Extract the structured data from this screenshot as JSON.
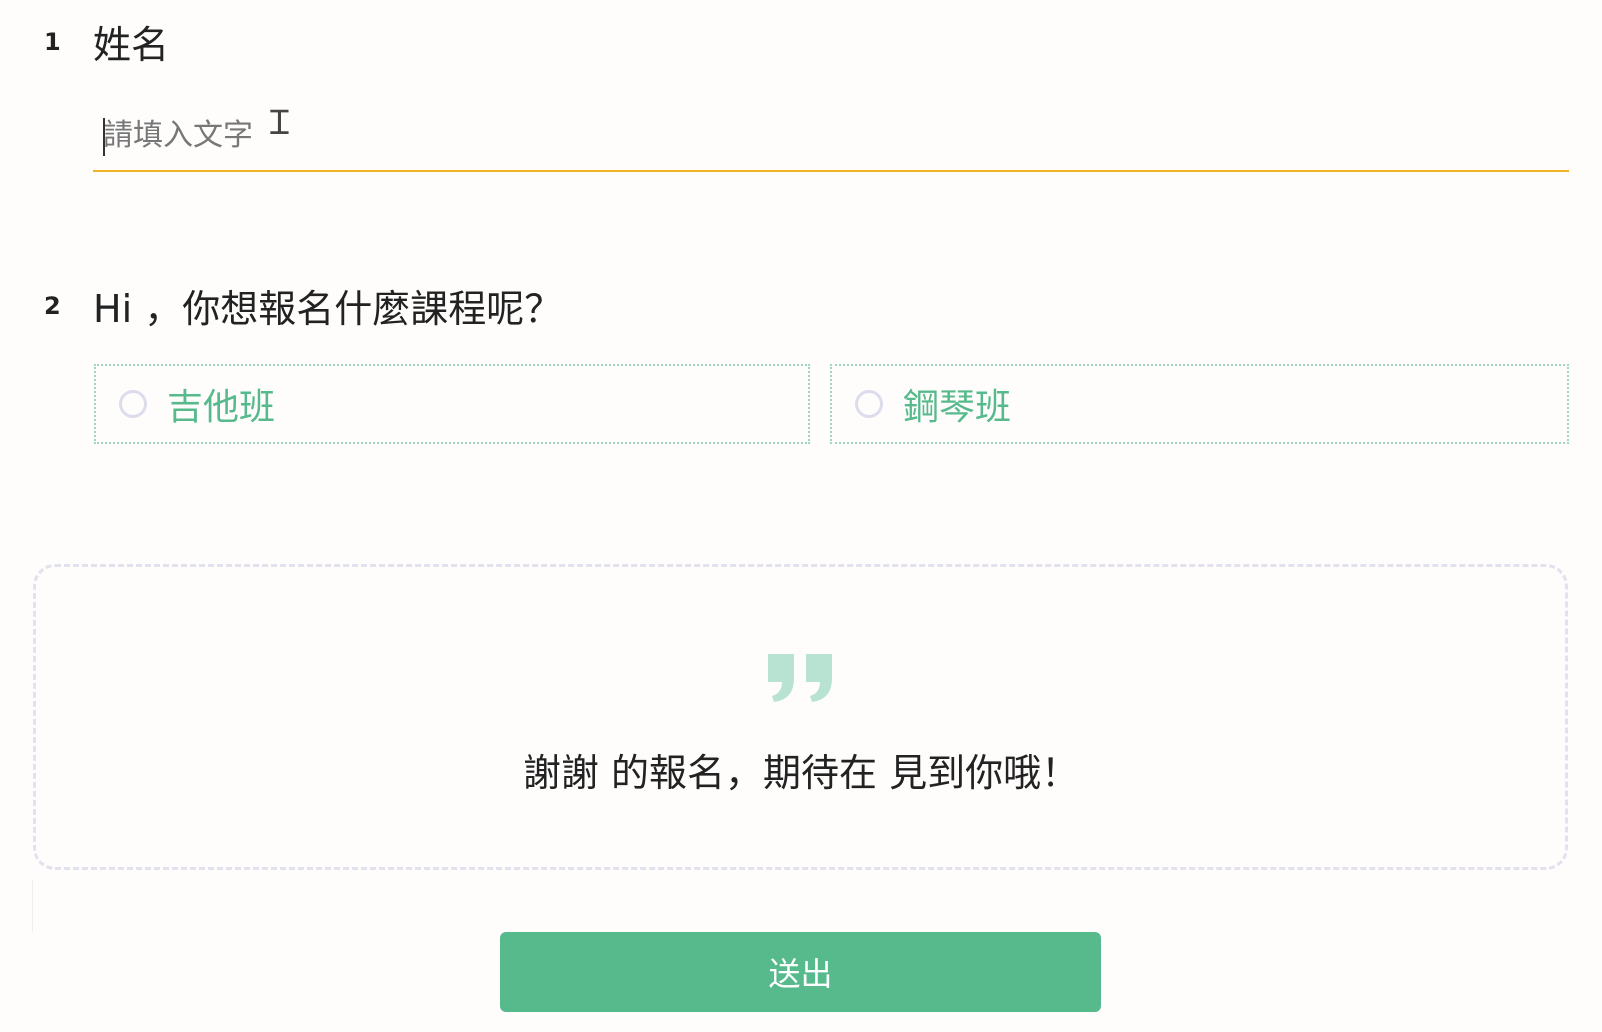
{
  "question1": {
    "number": "1",
    "title": "姓名",
    "input": {
      "placeholder": "請填入文字",
      "value": ""
    }
  },
  "question2": {
    "number": "2",
    "title": "Hi ，你想報名什麼課程呢？",
    "options": [
      {
        "label": "吉他班"
      },
      {
        "label": "鋼琴班"
      }
    ]
  },
  "thanks": {
    "icon": "quote-icon",
    "message": "謝謝 的報名，期待在 見到你哦！"
  },
  "submit": {
    "label": "送出"
  },
  "colors": {
    "accent": "#56ba8c",
    "input_underline": "#f0b324",
    "option_border": "#9fd6bf",
    "quote": "#b8e3d2",
    "dashed_border": "#e2e1ee"
  }
}
